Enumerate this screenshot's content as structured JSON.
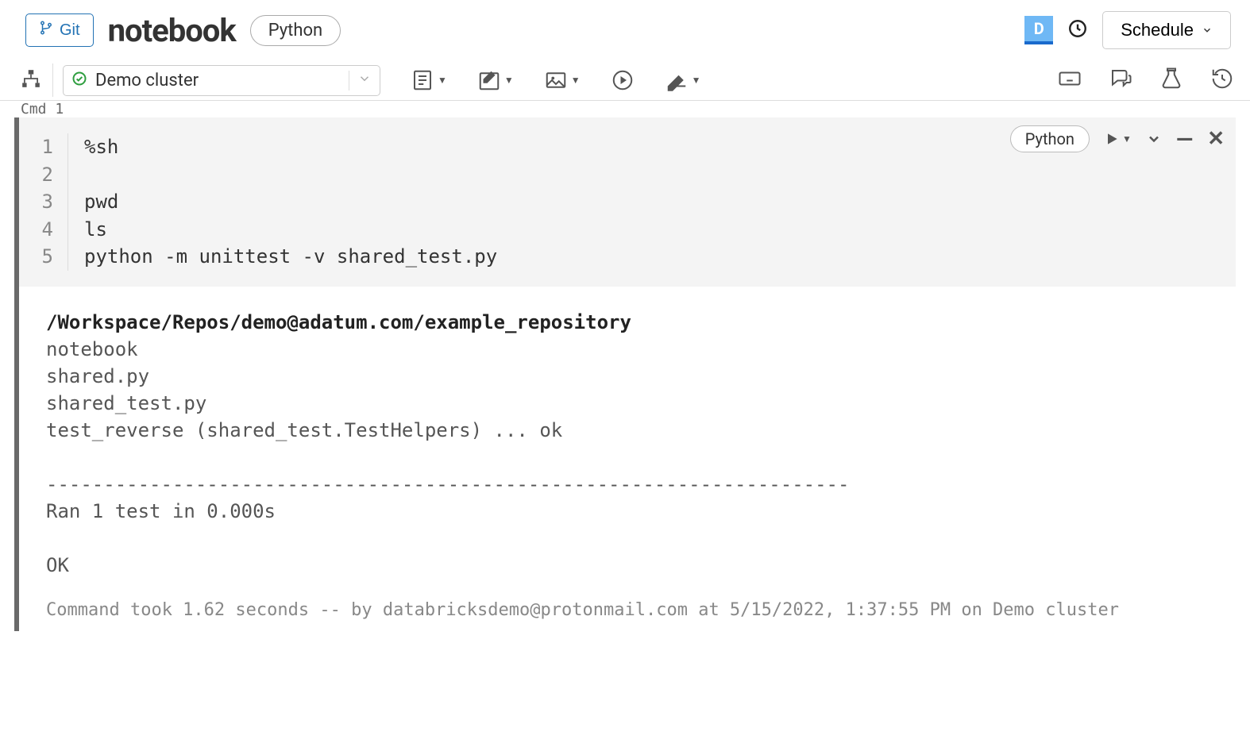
{
  "header": {
    "git_label": "Git",
    "title": "notebook",
    "language": "Python",
    "user_initial": "D",
    "schedule_label": "Schedule"
  },
  "toolbar": {
    "cluster_name": "Demo cluster"
  },
  "cell": {
    "cmd_label": "Cmd 1",
    "language_pill": "Python",
    "gutter": [
      "1",
      "2",
      "3",
      "4",
      "5"
    ],
    "code_lines": [
      "%sh",
      "",
      "pwd",
      "ls",
      "python -m unittest -v shared_test.py"
    ],
    "output_bold": "/Workspace/Repos/demo@adatum.com/example_repository",
    "output_lines": [
      "notebook",
      "shared.py",
      "shared_test.py",
      "test_reverse (shared_test.TestHelpers) ... ok",
      "",
      "----------------------------------------------------------------------",
      "Ran 1 test in 0.000s",
      "",
      "OK"
    ],
    "status": "Command took 1.62 seconds -- by databricksdemo@protonmail.com at 5/15/2022, 1:37:55 PM on Demo cluster"
  }
}
